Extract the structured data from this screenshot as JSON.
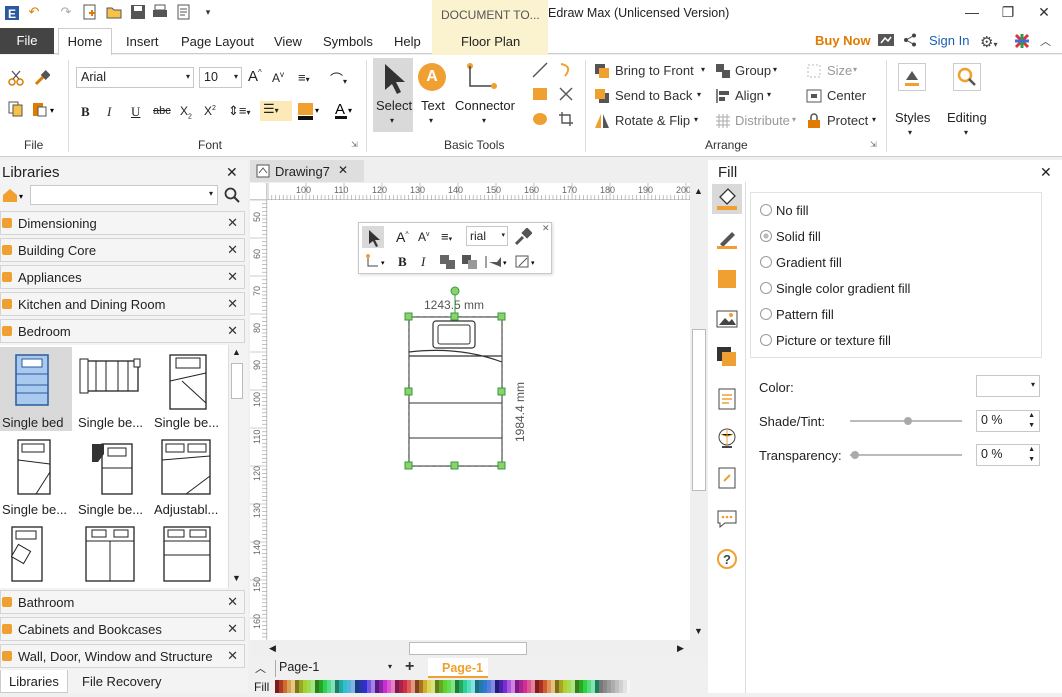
{
  "app": {
    "title": "Edraw Max (Unlicensed Version)",
    "doc_tools_tab": "DOCUMENT TO..."
  },
  "menu_tabs": [
    "File",
    "Home",
    "Insert",
    "Page Layout",
    "View",
    "Symbols",
    "Help",
    "Floor Plan"
  ],
  "header_links": {
    "buy_now": "Buy Now",
    "sign_in": "Sign In"
  },
  "ribbon": {
    "font_name": "Arial",
    "font_size": "10",
    "groups": {
      "file": "File",
      "font": "Font",
      "basic_tools": "Basic Tools",
      "arrange": "Arrange"
    },
    "basic_tools": {
      "select": "Select",
      "text": "Text",
      "text_glyph": "A",
      "connector": "Connector"
    },
    "arrange": {
      "bring_to_front": "Bring to Front",
      "send_to_back": "Send to Back",
      "rotate_flip": "Rotate & Flip",
      "group": "Group",
      "align": "Align",
      "distribute": "Distribute",
      "size": "Size",
      "center": "Center",
      "protect": "Protect"
    },
    "styles": "Styles",
    "editing": "Editing"
  },
  "libraries": {
    "title": "Libraries",
    "categories_top": [
      "Dimensioning",
      "Building Core",
      "Appliances",
      "Kitchen and Dining Room",
      "Bedroom"
    ],
    "shapes": [
      "Single bed",
      "Single be...",
      "Single be...",
      "Single be...",
      "Single be...",
      "Adjustabl...",
      "",
      "",
      ""
    ],
    "categories_bottom": [
      "Bathroom",
      "Cabinets and Bookcases",
      "Wall, Door, Window and Structure"
    ],
    "bottom_tabs": [
      "Libraries",
      "File Recovery"
    ]
  },
  "document": {
    "tab_name": "Drawing7",
    "ruler_h": [
      "100",
      "110",
      "120",
      "130",
      "140",
      "150",
      "160",
      "170",
      "180",
      "190",
      "200"
    ],
    "ruler_v": [
      "50",
      "60",
      "70",
      "80",
      "90",
      "100",
      "110",
      "120",
      "130",
      "140",
      "150",
      "160"
    ],
    "width_dim": "1243.5 mm",
    "height_dim": "1984.4 mm",
    "mini_font": "rial",
    "page_select": "Page-1",
    "page_tab": "Page-1",
    "fill_label": "Fill"
  },
  "fill_panel": {
    "title": "Fill",
    "options": [
      "No fill",
      "Solid fill",
      "Gradient fill",
      "Single color gradient fill",
      "Pattern fill",
      "Picture or texture fill"
    ],
    "selected_option": "Solid fill",
    "color_label": "Color:",
    "shade_label": "Shade/Tint:",
    "shade_value": "0 %",
    "transparency_label": "Transparency:",
    "transparency_value": "0 %"
  },
  "colors": {
    "accent_orange": "#f0a030",
    "link_blue": "#1a5fb4",
    "buy_orange": "#e07b00",
    "selection_green": "#2e9e3e"
  }
}
